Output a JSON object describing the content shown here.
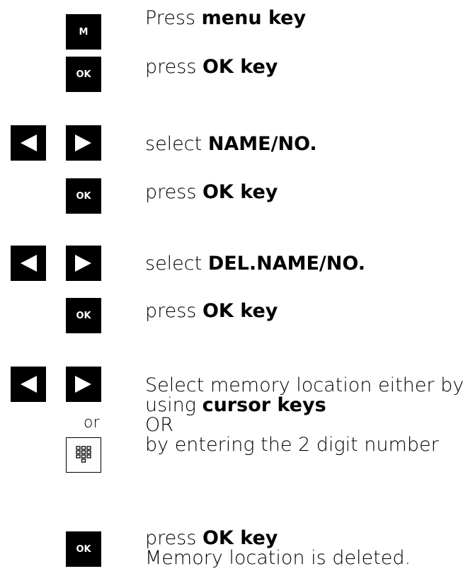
{
  "keys": {
    "menu": "M",
    "ok": "OK",
    "or": "or"
  },
  "icons": {
    "left": "left-arrow-key-icon",
    "right": "right-arrow-key-icon",
    "keypad": "keypad-icon"
  },
  "steps": [
    {
      "prefix": "Press ",
      "bold": "menu key"
    },
    {
      "prefix": "press ",
      "bold": "OK key"
    },
    {
      "prefix": "select ",
      "bold": "NAME/NO."
    },
    {
      "prefix": "press ",
      "bold": "OK key"
    },
    {
      "prefix": "select ",
      "bold": "DEL.NAME/NO."
    },
    {
      "prefix": "press ",
      "bold": "OK key"
    },
    {
      "line1": "Select memory location either by",
      "line2_prefix": "using ",
      "line2_bold": "cursor keys",
      "line3": "OR",
      "line4": "by entering the 2 digit number"
    },
    {
      "prefix": "press ",
      "bold": "OK key",
      "line2": "Memory location is deleted."
    }
  ]
}
